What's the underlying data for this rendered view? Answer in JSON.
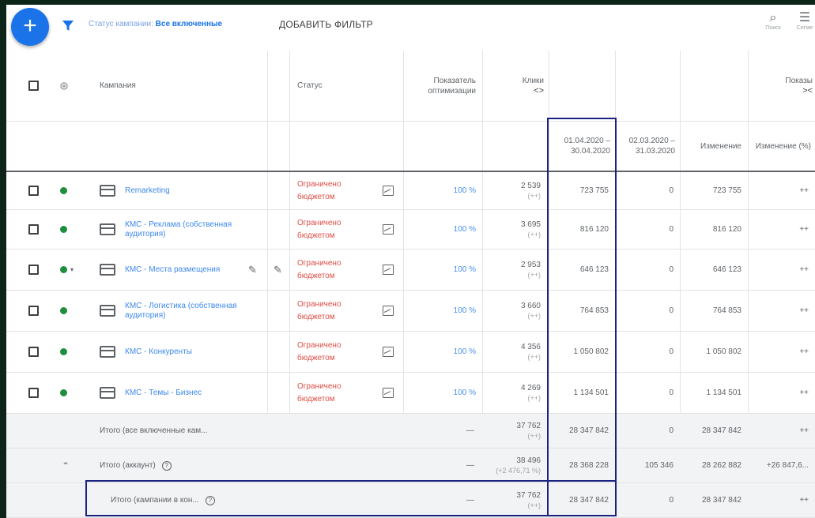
{
  "toolbar": {
    "add_label": "+",
    "filter_prefix": "Статус кампании:",
    "filter_value": "Все включенные",
    "add_filter": "ДОБАВИТЬ ФИЛЬТР",
    "search_label": "Поиск",
    "segments_label": "Сегме"
  },
  "headers": {
    "campaign": "Кампания",
    "status": "Статус",
    "optimization": "Показатель оптимизации",
    "clicks": "Клики",
    "clicks_arrows": "<>",
    "impressions": "Показы",
    "impressions_arrows": "><",
    "period_current": "01.04.2020 – 30.04.2020",
    "period_prev": "02.03.2020 – 31.03.2020",
    "change": "Изменение",
    "change_pct": "Изменение (%)"
  },
  "rows": [
    {
      "name": "Remarketing",
      "status": "Ограничено бюджетом",
      "opt": "100 %",
      "clicks": "2 539",
      "clicks_sub": "(++)",
      "cur": "723 755",
      "prev": "0",
      "change": "723 755",
      "pct": "++"
    },
    {
      "name": "КМС - Реклама (собственная аудитория)",
      "status": "Ограничено бюджетом",
      "opt": "100 %",
      "clicks": "3 695",
      "clicks_sub": "(++)",
      "cur": "816 120",
      "prev": "0",
      "change": "816 120",
      "pct": "++"
    },
    {
      "name": "КМС - Места размещения",
      "status": "Ограничено бюджетом",
      "opt": "100 %",
      "clicks": "2 953",
      "clicks_sub": "(++)",
      "cur": "646 123",
      "prev": "0",
      "change": "646 123",
      "pct": "++"
    },
    {
      "name": "КМС - Логистика (собственная аудитория)",
      "status": "Ограничено бюджетом",
      "opt": "100 %",
      "clicks": "3 660",
      "clicks_sub": "(++)",
      "cur": "764 853",
      "prev": "0",
      "change": "764 853",
      "pct": "++"
    },
    {
      "name": "КМС - Конкуренты",
      "status": "Ограничено бюджетом",
      "opt": "100 %",
      "clicks": "4 356",
      "clicks_sub": "(++)",
      "cur": "1 050 802",
      "prev": "0",
      "change": "1 050 802",
      "pct": "++"
    },
    {
      "name": "КМС - Темы - Бизнес",
      "status": "Ограничено бюджетом",
      "opt": "100 %",
      "clicks": "4 269",
      "clicks_sub": "(++)",
      "cur": "1 134 501",
      "prev": "0",
      "change": "1 134 501",
      "pct": "++"
    }
  ],
  "totals": [
    {
      "name": "Итого (все включенные кам...",
      "opt": "—",
      "clicks": "37 762",
      "clicks_sub": "(++)",
      "cur": "28 347 842",
      "prev": "0",
      "change": "28 347 842",
      "pct": "++"
    },
    {
      "name": "Итого (аккаунт)",
      "opt": "—",
      "clicks": "38 496",
      "clicks_sub": "(+2 476,71 %)",
      "cur": "28 368 228",
      "prev": "105 346",
      "change": "28 262 882",
      "pct": "+26 847,6..."
    },
    {
      "name": "Итого (кампании в кон...",
      "opt": "—",
      "clicks": "37 762",
      "clicks_sub": "(++)",
      "cur": "28 347 842",
      "prev": "0",
      "change": "28 347 842",
      "pct": "++"
    }
  ]
}
